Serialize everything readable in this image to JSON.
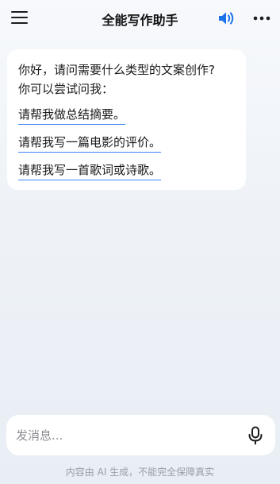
{
  "header": {
    "title": "全能写作助手",
    "menu_icon": "hamburger-menu-icon",
    "speaker_icon": "speaker-volume-icon",
    "more_icon": "more-dots-icon",
    "accent_color": "#1a73e8"
  },
  "chat": {
    "greeting_line1": "你好，请问需要什么类型的文案创作?",
    "greeting_line2": "你可以尝试问我：",
    "suggestions": [
      "请帮我做总结摘要。",
      "请帮我写一篇电影的评价。",
      "请帮我写一首歌词或诗歌。"
    ],
    "suggestion_underline_color": "#3b82f6"
  },
  "input": {
    "placeholder": "发消息...",
    "mic_icon": "microphone-icon"
  },
  "footer": {
    "disclaimer": "内容由 AI 生成，不能完全保障真实"
  }
}
